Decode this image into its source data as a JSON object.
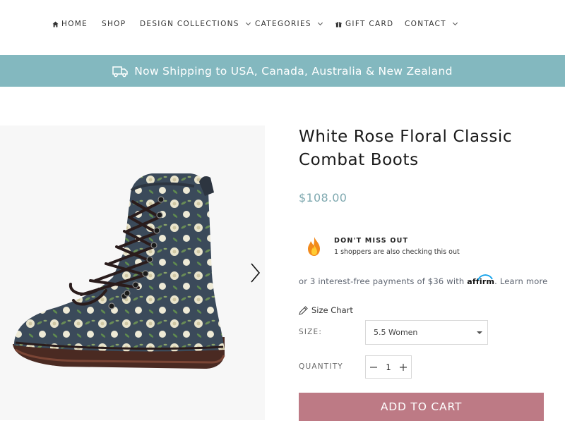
{
  "nav": {
    "items": [
      {
        "label": "HOME",
        "icon": "home-icon"
      },
      {
        "label": "SHOP"
      },
      {
        "label": "DESIGN COLLECTIONS",
        "dropdown": true
      },
      {
        "label": "CATEGORIES",
        "dropdown": true
      },
      {
        "label": "GIFT CARD",
        "icon": "gift-icon"
      },
      {
        "label": "CONTACT",
        "dropdown": true
      }
    ]
  },
  "banner": {
    "text": "Now Shipping to USA, Canada, Australia & New Zealand",
    "icon": "truck-icon",
    "color": "#83b8bf"
  },
  "gallery": {
    "image_alt": "floral combat boot",
    "next_icon": "chevron-right-icon"
  },
  "product": {
    "title": "White Rose Floral Classic Combat Boots",
    "price": "$108.00",
    "price_color": "#7fa9b0",
    "urgency": {
      "icon": "fire-icon",
      "title": "DON'T MISS OUT",
      "subtitle": "1 shoppers are also checking this out"
    },
    "affirm": {
      "prefix": "or 3 interest-free payments of $36 with",
      "brand": "affirm",
      "suffix": ".",
      "link": "Learn more"
    },
    "size_chart": {
      "label": "Size Chart",
      "icon": "pencil-icon"
    },
    "size": {
      "label": "SIZE:",
      "selected": "5.5 Women"
    },
    "quantity": {
      "label": "QUANTITY",
      "value": "1",
      "minus": "−",
      "plus": "+"
    },
    "add_to_cart": {
      "label": "ADD TO CART",
      "color": "#bd7a85"
    }
  }
}
